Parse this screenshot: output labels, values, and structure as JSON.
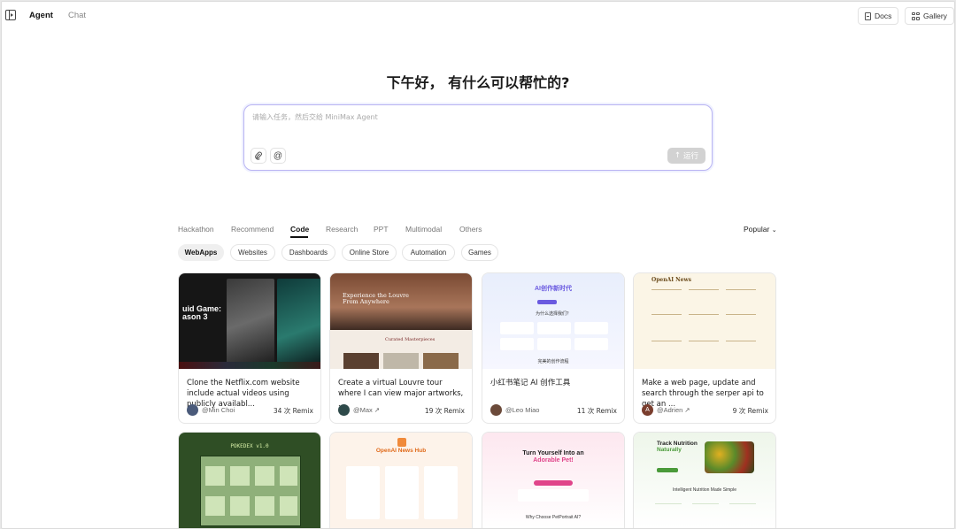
{
  "topbar": {
    "tabs": [
      {
        "label": "Agent",
        "active": true
      },
      {
        "label": "Chat",
        "active": false
      }
    ],
    "docs_label": "Docs",
    "gallery_label": "Gallery"
  },
  "greeting": "下午好， 有什么可以帮忙的?",
  "prompt": {
    "placeholder": "请输入任务，然后交给 MiniMax Agent",
    "value": "",
    "attach_icon": "paperclip-icon",
    "mention_icon": "at-icon",
    "run_label": "运行"
  },
  "categories": {
    "tabs": [
      "Hackathon",
      "Recommend",
      "Code",
      "Research",
      "PPT",
      "Multimodal",
      "Others"
    ],
    "active": "Code",
    "sort_label": "Popular"
  },
  "chips": {
    "items": [
      "WebApps",
      "Websites",
      "Dashboards",
      "Online Store",
      "Automation",
      "Games"
    ],
    "active": "WebApps"
  },
  "cards": [
    {
      "title": "Clone the Netflix.com website include actual videos using publicly availabl...",
      "author": "@Min Choi",
      "remix": "34 次 Remix",
      "thumb_text": [
        "uid Game:",
        "ason 3"
      ],
      "avatar_color": "#4a5a7a"
    },
    {
      "title": "Create a virtual Louvre tour where I can view major artworks, ...",
      "author": "@Max ↗",
      "remix": "19 次 Remix",
      "thumb_text": [
        "Experience the Louvre",
        "From Anywhere",
        "Curated Masterpieces"
      ],
      "avatar_color": "#2e4a4a"
    },
    {
      "title": "小红书笔记 AI 创作工具",
      "author": "@Leo Miao",
      "remix": "11 次 Remix",
      "thumb_text": [
        "AI创作新时代",
        "为什么选择我们？",
        "完美的创作流程"
      ],
      "avatar_color": "#6b4a3a"
    },
    {
      "title": "Make a web page, update and search through the serper api to get an ...",
      "author": "@Adrien ↗",
      "remix": "9 次 Remix",
      "thumb_text": [
        "OpenAI News"
      ],
      "avatar_color": "#7a3e2e",
      "avatar_letter": "A"
    },
    {
      "title": "",
      "thumb_text": [
        "POKEDEX v1.0"
      ]
    },
    {
      "title": "",
      "thumb_text": [
        "OpenAI News Hub"
      ]
    },
    {
      "title": "",
      "thumb_text": [
        "Turn Yourself Into an",
        "Adorable Pet!",
        "Why Choose PetPortrait AI?"
      ]
    },
    {
      "title": "",
      "thumb_text": [
        "Track Nutrition",
        "Naturally",
        "Intelligent Nutrition Made Simple"
      ]
    }
  ]
}
